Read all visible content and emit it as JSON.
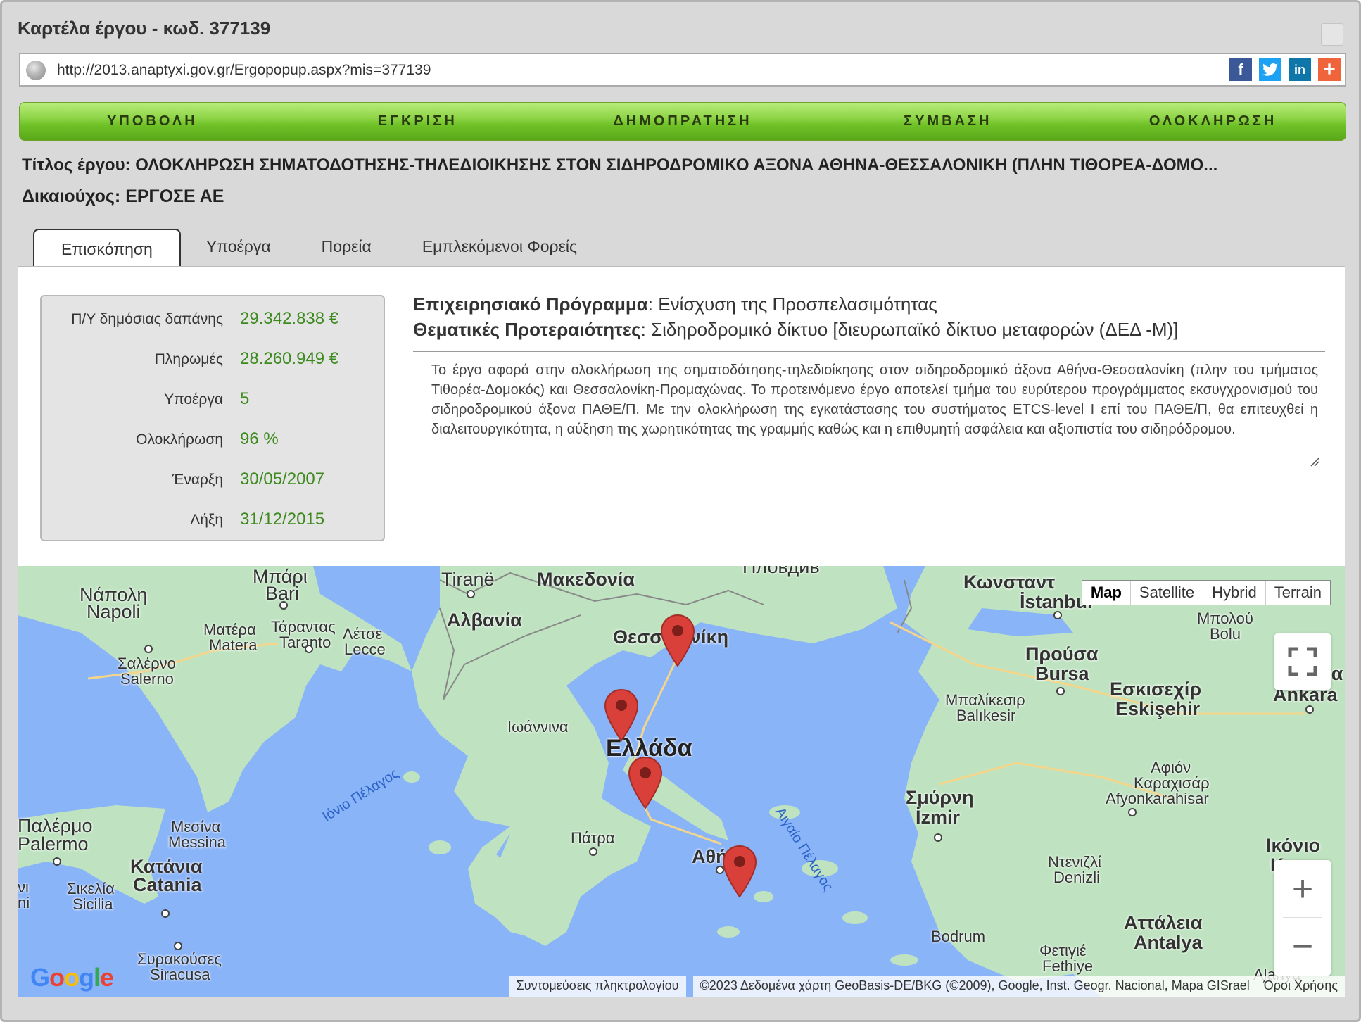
{
  "window": {
    "title": "Καρτέλα έργου - κωδ. 377139"
  },
  "url": {
    "text": "http://2013.anaptyxi.gov.gr/Ergopopup.aspx?mis=377139"
  },
  "share": [
    "f",
    "t",
    "in",
    "+"
  ],
  "stages": [
    "ΥΠΟΒΟΛΗ",
    "ΕΓΚΡΙΣΗ",
    "ΔΗΜΟΠΡΑΤΗΣΗ",
    "ΣΥΜΒΑΣΗ",
    "ΟΛΟΚΛΗΡΩΣΗ"
  ],
  "project": {
    "title_label": "Τίτλος έργου:",
    "title": "ΟΛΟΚΛΗΡΩΣΗ ΣΗΜΑΤΟΔΟΤΗΣΗΣ-ΤΗΛΕΔΙΟΙΚΗΣΗΣ ΣΤΟΝ ΣΙΔΗΡΟΔΡΟΜΙΚΟ ΑΞΟΝΑ ΑΘΗΝΑ-ΘΕΣΣΑΛΟΝΙΚΗ (ΠΛΗΝ ΤΙΘΟΡΕΑ-ΔΟΜΟ...",
    "owner_label": "Δικαιούχος:",
    "owner": "ΕΡΓΟΣΕ ΑΕ"
  },
  "tabs": [
    "Επισκόπηση",
    "Υποέργα",
    "Πορεία",
    "Εμπλεκόμενοι Φορείς"
  ],
  "stats": [
    {
      "label": "Π/Υ δημόσιας δαπάνης",
      "value": "29.342.838 €"
    },
    {
      "label": "Πληρωμές",
      "value": "28.260.949 €"
    },
    {
      "label": "Υποέργα",
      "value": "5"
    },
    {
      "label": "Ολοκλήρωση",
      "value": "96 %"
    },
    {
      "label": "Έναρξη",
      "value": "30/05/2007"
    },
    {
      "label": "Λήξη",
      "value": "31/12/2015"
    }
  ],
  "program": {
    "op_label": "Επιχειρησιακό Πρόγραμμα",
    "op_value": ": Ενίσχυση της Προσπελασιμότητας",
    "priority_label": "Θεματικές Προτεραιότητες",
    "priority_value": ": Σιδηροδρομικό δίκτυο [διευρωπαϊκό δίκτυο μεταφορών (ΔΕΔ -Μ)]"
  },
  "description": "Το έργο αφορά στην ολοκλήρωση της σηματοδότησης-τηλεδιοίκησης στον σιδηροδρομικό άξονα Αθήνα-Θεσσαλονίκη (πλην του τμήματος Τιθορέα-Δομοκός) και Θεσσαλονίκη-Προμαχώνας. Το προτεινόμενο έργο αποτελεί τμήμα του ευρύτερου προγράμματος εκσυγχρονισμού του σιδηροδρομικού άξονα ΠΑΘΕ/Π. Με την ολοκλήρωση της εγκατάστασης του συστήματος ETCS-level I επί του ΠΑΘΕ/Π, θα επιτευχθεί η διαλειτουργικότητα, η αύξηση της χωρητικότητας της γραμμής καθώς και η επιθυμητή ασφάλεια και αξιοπιστία του σιδηρόδρομου.",
  "map": {
    "types": [
      "Map",
      "Satellite",
      "Hybrid",
      "Terrain"
    ],
    "selected_type": "Map",
    "zoom_in": "+",
    "zoom_out": "−",
    "keyboard": "Συντομεύσεις πληκτρολογίου",
    "copyright": "©2023 Δεδομένα χάρτη GeoBasis-DE/BKG (©2009), Google, Inst. Geogr. Nacional, Mapa GISrael",
    "terms": "Όροι Χρήσης",
    "google": "Google",
    "labels": {
      "napoli_gr": "Νάπολη",
      "napoli": "Napoli",
      "bari_gr": "Μπάρι",
      "bari": "Bari",
      "matera_gr": "Ματέρα",
      "matera": "Matera",
      "taranto_gr": "Τάραντας",
      "taranto": "Taranto",
      "lecce_gr": "Λέτσε",
      "lecce": "Lecce",
      "salerno_gr": "Σαλέρνο",
      "salerno": "Salerno",
      "tirane": "Tiranë",
      "albania": "Αλβανία",
      "macedonia": "Μακεδονία",
      "plovdiv": "Пловдив",
      "thessaloniki_a": "Θεσσα",
      "thessaloniki_b": "νίκη",
      "ioannina": "Ιωάννινα",
      "ellada": "Ελλάδα",
      "patra": "Πάτρα",
      "athina": "Αθή",
      "ionian": "Ιόνιο Πέλαγος",
      "aegean": "Αιγαίο Πέλαγος",
      "palermo_gr": "Παλέρμο",
      "palermo": "Palermo",
      "messina_gr": "Μεσίνα",
      "messina": "Messina",
      "catania_gr": "Κατάνια",
      "catania": "Catania",
      "sicily_gr": "Σικελία",
      "sicily": "Sicilia",
      "siracusa_gr": "Συρακούσες",
      "siracusa": "Siracusa",
      "vni": "νι",
      "ni": "ni",
      "istanbul_gr": "Κωνσταντ",
      "istanbul": "İstanbul",
      "bolu_gr": "Μπολού",
      "bolu": "Bolu",
      "bursa_gr": "Προύσα",
      "bursa": "Bursa",
      "balikesir_gr": "Μπαλίκεσιρ",
      "balikesir": "Balıkesir",
      "eskisehir_gr": "Εσκισεχίρ",
      "eskisehir": "Eskişehir",
      "ankara": "Ankara",
      "ankara_frag": "ρα",
      "afyon_gr1": "Αφιόν",
      "afyon_gr2": "Καραχισάρ",
      "afyon": "Afyonkarahisar",
      "izmir_gr": "Σμύρνη",
      "izmir": "İzmir",
      "denizli_gr": "Ντενιζλί",
      "denizli": "Denizli",
      "konya_gr": "Ικόνιο",
      "konya": "Ko",
      "antalya_gr": "Αττάλεια",
      "antalya": "Antalya",
      "bodrum": "Bodrum",
      "fethiye_gr": "Φετιγιέ",
      "fethiye": "Fethiye",
      "alanya": "Alanya"
    }
  }
}
